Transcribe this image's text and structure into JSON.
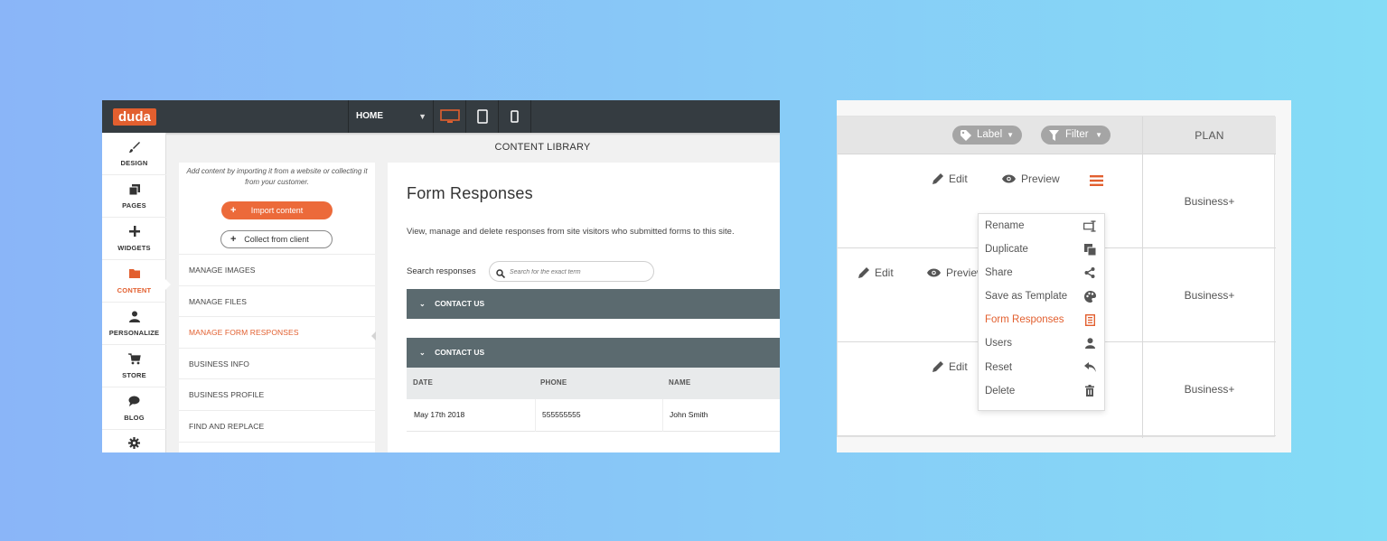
{
  "editor": {
    "logo": "duda",
    "page_select": "HOME",
    "sidebar": [
      {
        "label": "DESIGN",
        "icon": "brush-icon"
      },
      {
        "label": "PAGES",
        "icon": "pages-icon"
      },
      {
        "label": "WIDGETS",
        "icon": "plus-icon"
      },
      {
        "label": "CONTENT",
        "icon": "folder-icon"
      },
      {
        "label": "PERSONALIZE",
        "icon": "person-icon"
      },
      {
        "label": "STORE",
        "icon": "cart-icon"
      },
      {
        "label": "BLOG",
        "icon": "chat-icon"
      },
      {
        "label": "",
        "icon": "gear-icon"
      }
    ],
    "content_library_title": "CONTENT LIBRARY",
    "menu": {
      "intro": "Add content by importing it from a website or collecting it from your customer.",
      "import_label": "Import content",
      "collect_label": "Collect from client",
      "items": [
        "MANAGE IMAGES",
        "MANAGE FILES",
        "MANAGE FORM RESPONSES",
        "BUSINESS INFO",
        "BUSINESS PROFILE",
        "FIND AND REPLACE"
      ]
    },
    "form_responses": {
      "title": "Form Responses",
      "description": "View, manage and delete responses from site visitors who submitted forms to this site.",
      "search_label": "Search responses",
      "search_placeholder": "Search for the exact term",
      "groups": [
        "CONTACT US",
        "CONTACT US"
      ],
      "columns": [
        "DATE",
        "PHONE",
        "NAME"
      ],
      "rows": [
        {
          "date": "May 17th 2018",
          "phone": "555555555",
          "name": "John Smith"
        }
      ]
    },
    "colors": {
      "accent": "#e25f2f",
      "topbar": "#353c41",
      "accordion": "#5b6a6f"
    }
  },
  "sites": {
    "label_filter": "Label",
    "filter": "Filter",
    "plan_header": "PLAN",
    "edit_label": "Edit",
    "preview_label": "Preview",
    "rows": [
      {
        "plan": "Business+"
      },
      {
        "plan": "Business+"
      },
      {
        "plan": "Business+"
      }
    ],
    "context_menu": [
      {
        "label": "Rename",
        "icon": "rename-icon"
      },
      {
        "label": "Duplicate",
        "icon": "duplicate-icon"
      },
      {
        "label": "Share",
        "icon": "share-icon"
      },
      {
        "label": "Save as Template",
        "icon": "palette-icon"
      },
      {
        "label": "Form Responses",
        "icon": "form-icon"
      },
      {
        "label": "Users",
        "icon": "user-icon"
      },
      {
        "label": "Reset",
        "icon": "reset-icon"
      },
      {
        "label": "Delete",
        "icon": "trash-icon"
      }
    ]
  }
}
